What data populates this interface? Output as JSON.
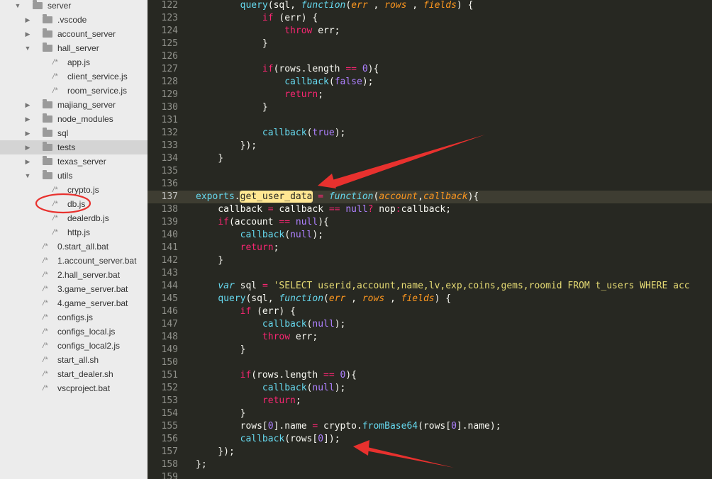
{
  "sidebar": {
    "items": [
      {
        "label": "server",
        "type": "folder",
        "depth": 0,
        "open": true,
        "selected": false
      },
      {
        "label": ".vscode",
        "type": "folder",
        "depth": 1,
        "open": false,
        "selected": false
      },
      {
        "label": "account_server",
        "type": "folder",
        "depth": 1,
        "open": false,
        "selected": false
      },
      {
        "label": "hall_server",
        "type": "folder",
        "depth": 1,
        "open": true,
        "selected": false
      },
      {
        "label": "app.js",
        "type": "file",
        "depth": 2,
        "open": false,
        "selected": false
      },
      {
        "label": "client_service.js",
        "type": "file",
        "depth": 2,
        "open": false,
        "selected": false
      },
      {
        "label": "room_service.js",
        "type": "file",
        "depth": 2,
        "open": false,
        "selected": false
      },
      {
        "label": "majiang_server",
        "type": "folder",
        "depth": 1,
        "open": false,
        "selected": false
      },
      {
        "label": "node_modules",
        "type": "folder",
        "depth": 1,
        "open": false,
        "selected": false
      },
      {
        "label": "sql",
        "type": "folder",
        "depth": 1,
        "open": false,
        "selected": false
      },
      {
        "label": "tests",
        "type": "folder",
        "depth": 1,
        "open": false,
        "selected": true
      },
      {
        "label": "texas_server",
        "type": "folder",
        "depth": 1,
        "open": false,
        "selected": false
      },
      {
        "label": "utils",
        "type": "folder",
        "depth": 1,
        "open": true,
        "selected": false
      },
      {
        "label": "crypto.js",
        "type": "file",
        "depth": 2,
        "open": false,
        "selected": false
      },
      {
        "label": "db.js",
        "type": "file",
        "depth": 2,
        "open": false,
        "selected": true
      },
      {
        "label": "dealerdb.js",
        "type": "file",
        "depth": 2,
        "open": false,
        "selected": false
      },
      {
        "label": "http.js",
        "type": "file",
        "depth": 2,
        "open": false,
        "selected": false
      },
      {
        "label": "0.start_all.bat",
        "type": "file",
        "depth": 1,
        "open": false,
        "selected": false
      },
      {
        "label": "1.account_server.bat",
        "type": "file",
        "depth": 1,
        "open": false,
        "selected": false
      },
      {
        "label": "2.hall_server.bat",
        "type": "file",
        "depth": 1,
        "open": false,
        "selected": false
      },
      {
        "label": "3.game_server.bat",
        "type": "file",
        "depth": 1,
        "open": false,
        "selected": false
      },
      {
        "label": "4.game_server.bat",
        "type": "file",
        "depth": 1,
        "open": false,
        "selected": false
      },
      {
        "label": "configs.js",
        "type": "file",
        "depth": 1,
        "open": false,
        "selected": false
      },
      {
        "label": "configs_local.js",
        "type": "file",
        "depth": 1,
        "open": false,
        "selected": false
      },
      {
        "label": "configs_local2.js",
        "type": "file",
        "depth": 1,
        "open": false,
        "selected": false
      },
      {
        "label": "start_all.sh",
        "type": "file",
        "depth": 1,
        "open": false,
        "selected": false
      },
      {
        "label": "start_dealer.sh",
        "type": "file",
        "depth": 1,
        "open": false,
        "selected": false
      },
      {
        "label": "vscproject.bat",
        "type": "file",
        "depth": 1,
        "open": false,
        "selected": false
      }
    ]
  },
  "editor": {
    "active_line": 137,
    "lines": [
      {
        "n": "122",
        "tokens": [
          [
            "",
            "        "
          ],
          [
            "fn",
            "query"
          ],
          [
            "",
            "(sql, "
          ],
          [
            "sto",
            "function"
          ],
          [
            "",
            "("
          ],
          [
            "par",
            "err"
          ],
          [
            "",
            " , "
          ],
          [
            "par",
            "rows"
          ],
          [
            "",
            " , "
          ],
          [
            "par",
            "fields"
          ],
          [
            "",
            ") {"
          ]
        ]
      },
      {
        "n": "123",
        "tokens": [
          [
            "",
            "            "
          ],
          [
            "kw",
            "if"
          ],
          [
            "",
            " (err) {"
          ]
        ]
      },
      {
        "n": "124",
        "tokens": [
          [
            "",
            "                "
          ],
          [
            "kw",
            "throw"
          ],
          [
            "",
            " err;"
          ]
        ]
      },
      {
        "n": "125",
        "tokens": [
          [
            "",
            "            }"
          ]
        ]
      },
      {
        "n": "126",
        "tokens": []
      },
      {
        "n": "127",
        "tokens": [
          [
            "",
            "            "
          ],
          [
            "kw",
            "if"
          ],
          [
            "",
            "(rows.length "
          ],
          [
            "kw",
            "=="
          ],
          [
            "",
            " "
          ],
          [
            "num",
            "0"
          ],
          [
            "",
            "){"
          ]
        ]
      },
      {
        "n": "128",
        "tokens": [
          [
            "",
            "                "
          ],
          [
            "fn",
            "callback"
          ],
          [
            "",
            "("
          ],
          [
            "num",
            "false"
          ],
          [
            "",
            ");"
          ]
        ]
      },
      {
        "n": "129",
        "tokens": [
          [
            "",
            "                "
          ],
          [
            "kw",
            "return"
          ],
          [
            "",
            ";"
          ]
        ]
      },
      {
        "n": "130",
        "tokens": [
          [
            "",
            "            }"
          ]
        ]
      },
      {
        "n": "131",
        "tokens": []
      },
      {
        "n": "132",
        "tokens": [
          [
            "",
            "            "
          ],
          [
            "fn",
            "callback"
          ],
          [
            "",
            "("
          ],
          [
            "num",
            "true"
          ],
          [
            "",
            ");"
          ]
        ]
      },
      {
        "n": "133",
        "tokens": [
          [
            "",
            "        });"
          ]
        ]
      },
      {
        "n": "134",
        "tokens": [
          [
            "",
            "    }"
          ]
        ]
      },
      {
        "n": "135",
        "tokens": []
      },
      {
        "n": "136",
        "tokens": []
      },
      {
        "n": "137",
        "tokens": [
          [
            "fn",
            "exports"
          ],
          [
            "",
            "."
          ],
          [
            "hl",
            "get_user_data"
          ],
          [
            "",
            " "
          ],
          [
            "kw",
            "="
          ],
          [
            "",
            " "
          ],
          [
            "sto",
            "function"
          ],
          [
            "",
            "("
          ],
          [
            "par",
            "account"
          ],
          [
            "",
            ","
          ],
          [
            "par",
            "callback"
          ],
          [
            "",
            "){"
          ]
        ]
      },
      {
        "n": "138",
        "tokens": [
          [
            "",
            "    callback "
          ],
          [
            "kw",
            "="
          ],
          [
            "",
            " callback "
          ],
          [
            "kw",
            "=="
          ],
          [
            "",
            " "
          ],
          [
            "num",
            "null"
          ],
          [
            "kw",
            "?"
          ],
          [
            "",
            " nop"
          ],
          [
            "kw",
            ":"
          ],
          [
            "",
            "callback;"
          ]
        ]
      },
      {
        "n": "139",
        "tokens": [
          [
            "",
            "    "
          ],
          [
            "kw",
            "if"
          ],
          [
            "",
            "(account "
          ],
          [
            "kw",
            "=="
          ],
          [
            "",
            " "
          ],
          [
            "num",
            "null"
          ],
          [
            "",
            "){"
          ]
        ]
      },
      {
        "n": "140",
        "tokens": [
          [
            "",
            "        "
          ],
          [
            "fn",
            "callback"
          ],
          [
            "",
            "("
          ],
          [
            "num",
            "null"
          ],
          [
            "",
            ");"
          ]
        ]
      },
      {
        "n": "141",
        "tokens": [
          [
            "",
            "        "
          ],
          [
            "kw",
            "return"
          ],
          [
            "",
            ";"
          ]
        ]
      },
      {
        "n": "142",
        "tokens": [
          [
            "",
            "    }"
          ]
        ]
      },
      {
        "n": "143",
        "tokens": []
      },
      {
        "n": "144",
        "tokens": [
          [
            "",
            "    "
          ],
          [
            "sto",
            "var"
          ],
          [
            "",
            " sql "
          ],
          [
            "kw",
            "="
          ],
          [
            "",
            " "
          ],
          [
            "str",
            "'SELECT userid,account,name,lv,exp,coins,gems,roomid FROM t_users WHERE acc"
          ]
        ]
      },
      {
        "n": "145",
        "tokens": [
          [
            "",
            "    "
          ],
          [
            "fn",
            "query"
          ],
          [
            "",
            "(sql, "
          ],
          [
            "sto",
            "function"
          ],
          [
            "",
            "("
          ],
          [
            "par",
            "err"
          ],
          [
            "",
            " , "
          ],
          [
            "par",
            "rows"
          ],
          [
            "",
            " , "
          ],
          [
            "par",
            "fields"
          ],
          [
            "",
            ") {"
          ]
        ]
      },
      {
        "n": "146",
        "tokens": [
          [
            "",
            "        "
          ],
          [
            "kw",
            "if"
          ],
          [
            "",
            " (err) {"
          ]
        ]
      },
      {
        "n": "147",
        "tokens": [
          [
            "",
            "            "
          ],
          [
            "fn",
            "callback"
          ],
          [
            "",
            "("
          ],
          [
            "num",
            "null"
          ],
          [
            "",
            ");"
          ]
        ]
      },
      {
        "n": "148",
        "tokens": [
          [
            "",
            "            "
          ],
          [
            "kw",
            "throw"
          ],
          [
            "",
            " err;"
          ]
        ]
      },
      {
        "n": "149",
        "tokens": [
          [
            "",
            "        }"
          ]
        ]
      },
      {
        "n": "150",
        "tokens": []
      },
      {
        "n": "151",
        "tokens": [
          [
            "",
            "        "
          ],
          [
            "kw",
            "if"
          ],
          [
            "",
            "(rows.length "
          ],
          [
            "kw",
            "=="
          ],
          [
            "",
            " "
          ],
          [
            "num",
            "0"
          ],
          [
            "",
            "){"
          ]
        ]
      },
      {
        "n": "152",
        "tokens": [
          [
            "",
            "            "
          ],
          [
            "fn",
            "callback"
          ],
          [
            "",
            "("
          ],
          [
            "num",
            "null"
          ],
          [
            "",
            ");"
          ]
        ]
      },
      {
        "n": "153",
        "tokens": [
          [
            "",
            "            "
          ],
          [
            "kw",
            "return"
          ],
          [
            "",
            ";"
          ]
        ]
      },
      {
        "n": "154",
        "tokens": [
          [
            "",
            "        }"
          ]
        ]
      },
      {
        "n": "155",
        "tokens": [
          [
            "",
            "        rows["
          ],
          [
            "num",
            "0"
          ],
          [
            "",
            "].name "
          ],
          [
            "kw",
            "="
          ],
          [
            "",
            " crypto."
          ],
          [
            "fn",
            "fromBase64"
          ],
          [
            "",
            "(rows["
          ],
          [
            "num",
            "0"
          ],
          [
            "",
            "].name);"
          ]
        ]
      },
      {
        "n": "156",
        "tokens": [
          [
            "",
            "        "
          ],
          [
            "fn",
            "callback"
          ],
          [
            "",
            "(rows["
          ],
          [
            "num",
            "0"
          ],
          [
            "",
            "]);"
          ]
        ]
      },
      {
        "n": "157",
        "tokens": [
          [
            "",
            "    });"
          ]
        ]
      },
      {
        "n": "158",
        "tokens": [
          [
            "",
            "};"
          ]
        ]
      },
      {
        "n": "159",
        "tokens": []
      }
    ]
  },
  "colors": {
    "background": "#272822",
    "keyword": "#f92672",
    "function": "#66d9ef",
    "parameter": "#fd971f",
    "number": "#ae81ff",
    "string": "#e6db74",
    "annotation": "#e8312e"
  }
}
